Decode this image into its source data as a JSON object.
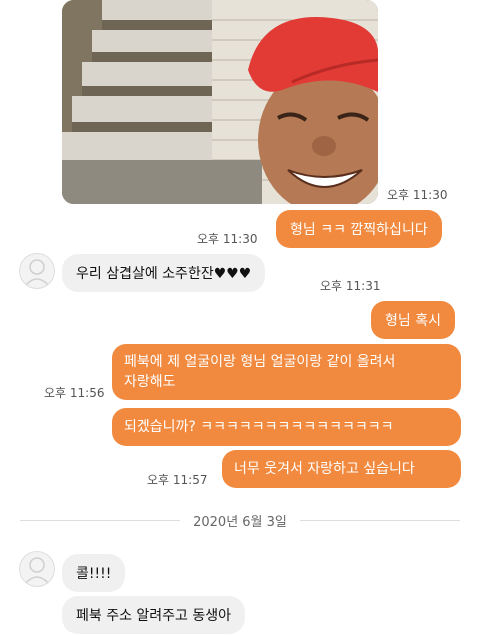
{
  "messages": {
    "photo_time": "오후 11:30",
    "m1_text": "형님 ㅋㅋ 깜찍하십니다",
    "m1_time": "오후 11:30",
    "m2_text": "우리 삼겹살에 소주한잔♥♥♥",
    "m2_time": "오후 11:31",
    "m3_text": "형님 혹시",
    "m4_line1": "페북에 제 얼굴이랑 형님 얼굴이랑 같이 올려서",
    "m4_line2": "자랑해도",
    "m4_time": "오후 11:56",
    "m5_text": "되겠습니까? ㅋㅋㅋㅋㅋㅋㅋㅋㅋㅋㅋㅋㅋㅋㅋ",
    "m6_text": "너무 웃겨서 자랑하고 싶습니다",
    "m6_time": "오후 11:57",
    "date_divider": "2020년 6월 3일",
    "m7_text": "콜!!!!",
    "m8_text": "페북 주소 알려주고 동생아"
  },
  "icons": {
    "avatar": "default-profile-avatar"
  },
  "colors": {
    "outgoing_bubble": "#f18a3f",
    "incoming_bubble": "#f0f0f0",
    "timestamp": "#555555"
  }
}
